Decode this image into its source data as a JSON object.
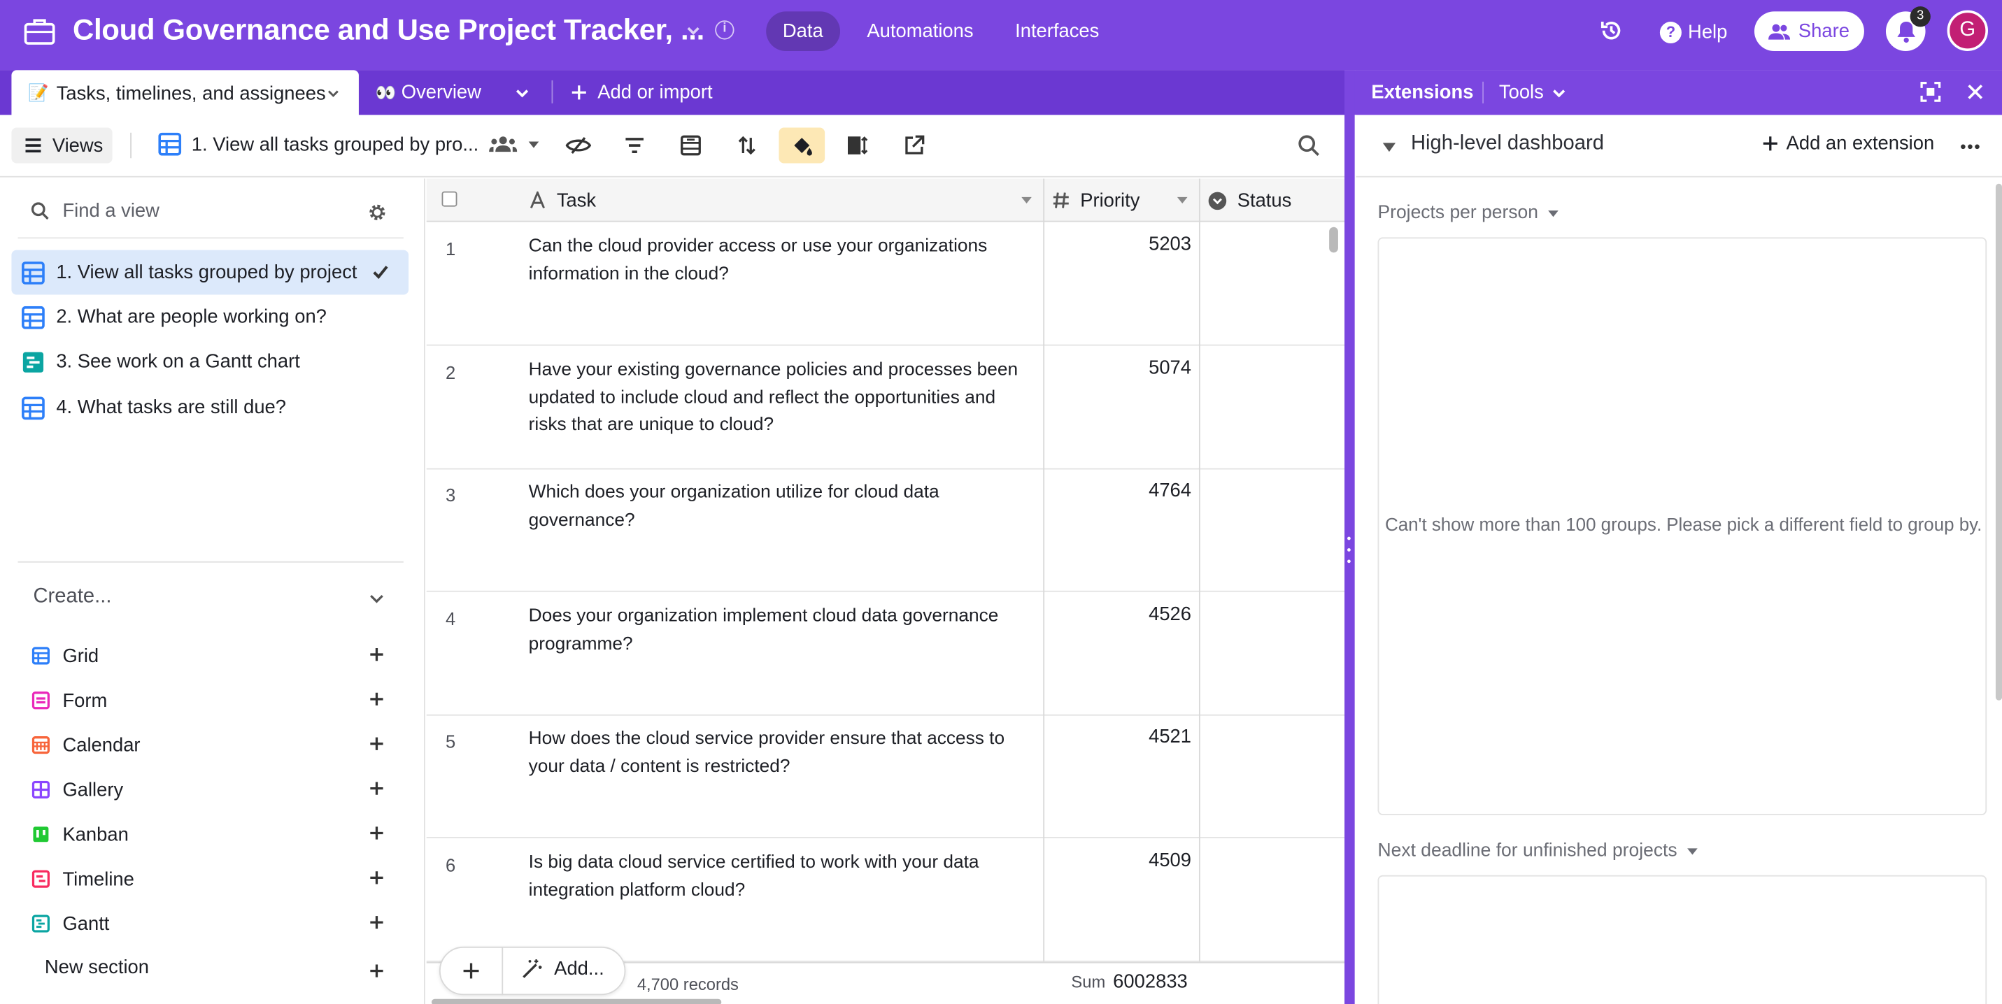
{
  "topbar": {
    "base_title": "Cloud Governance and Use Project Tracker, ...",
    "nav_tabs": [
      "Data",
      "Automations",
      "Interfaces"
    ],
    "help_label": "Help",
    "share_label": "Share",
    "notification_count": "3",
    "avatar_initial": "G",
    "accent_color": "#7b46e0"
  },
  "tables": {
    "active_tab": {
      "emoji": "📝",
      "label": "Tasks, timelines, and assignees"
    },
    "other_tab": {
      "emoji": "👀",
      "label": "Overview"
    },
    "add_import_label": "Add or import"
  },
  "viewbar": {
    "views_label": "Views",
    "current_view_name": "1. View all tasks grouped by pro...",
    "toolbar_icons": [
      "hide-fields-icon",
      "filter-icon",
      "group-icon",
      "sort-icon",
      "color-icon",
      "row-height-icon",
      "share-view-icon",
      "search-icon"
    ]
  },
  "sidebar": {
    "find_placeholder": "Find a view",
    "views": [
      {
        "label": "1. View all tasks grouped by project",
        "type": "grid",
        "active": true
      },
      {
        "label": "2. What are people working on?",
        "type": "grid",
        "active": false
      },
      {
        "label": "3. See work on a Gantt chart",
        "type": "gantt",
        "active": false
      },
      {
        "label": "4. What tasks are still due?",
        "type": "grid",
        "active": false
      }
    ],
    "create_heading": "Create...",
    "create_items": [
      {
        "label": "Grid",
        "color": "#2d7ff9"
      },
      {
        "label": "Form",
        "color": "#e929ba"
      },
      {
        "label": "Calendar",
        "color": "#f7653b"
      },
      {
        "label": "Gallery",
        "color": "#8b46ff"
      },
      {
        "label": "Kanban",
        "color": "#20c933"
      },
      {
        "label": "Timeline",
        "color": "#f82b60"
      },
      {
        "label": "Gantt",
        "color": "#0ba5a2"
      }
    ],
    "new_section_label": "New section"
  },
  "grid": {
    "columns": [
      "Task",
      "Priority",
      "Status"
    ],
    "rows": [
      {
        "num": "1",
        "task": "Can the cloud provider access or use your organizations information in the cloud?",
        "priority": "5203"
      },
      {
        "num": "2",
        "task": "Have your existing governance policies and processes been updated to include cloud and reflect the opportunities and risks that are unique to cloud?",
        "priority": "5074"
      },
      {
        "num": "3",
        "task": "Which does your organization utilize for cloud data governance?",
        "priority": "4764"
      },
      {
        "num": "4",
        "task": "Does your organization implement cloud data governance programme?",
        "priority": "4526"
      },
      {
        "num": "5",
        "task": "How does the cloud service provider ensure that access to your data / content is restricted?",
        "priority": "4521"
      },
      {
        "num": "6",
        "task": "Is big data cloud service certified to work with your data integration platform cloud?",
        "priority": "4509"
      }
    ],
    "add_label": "Add...",
    "records_label": "4,700 records",
    "sum_label": "Sum",
    "sum_value": "6002833"
  },
  "extensions": {
    "title": "Extensions",
    "tools_label": "Tools",
    "dashboard_title": "High-level dashboard",
    "add_extension_label": "Add an extension",
    "widgets": [
      {
        "label": "Projects per person",
        "message": "Can't show more than 100 groups. Please pick a different field to group by."
      },
      {
        "label": "Next deadline for unfinished projects",
        "message": ""
      }
    ]
  }
}
